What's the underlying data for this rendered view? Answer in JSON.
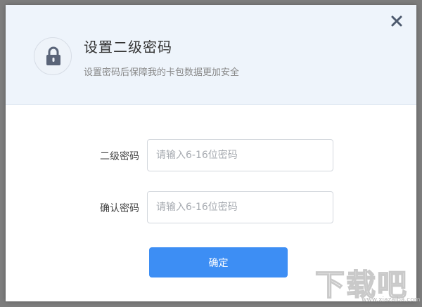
{
  "dialog": {
    "title": "设置二级密码",
    "subtitle": "设置密码后保障我的卡包数据更加安全",
    "close_icon": "close-icon",
    "lock_icon": "lock-icon"
  },
  "form": {
    "fields": [
      {
        "label": "二级密码",
        "placeholder": "请输入6-16位密码",
        "value": ""
      },
      {
        "label": "确认密码",
        "placeholder": "请输入6-16位密码",
        "value": ""
      }
    ],
    "confirm_label": "确定"
  },
  "watermark": {
    "logo_text": "下载吧",
    "site": "www.xiazaiba.com"
  },
  "colors": {
    "accent": "#3d8ef4",
    "header_bg": "#eef4fb",
    "icon": "#5a6478"
  }
}
